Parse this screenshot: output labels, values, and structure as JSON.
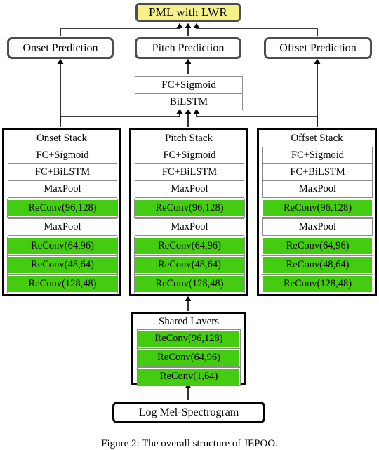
{
  "figure": {
    "caption": "Figure 2:  The overall structure of JEPOO.",
    "colors": {
      "highlight_yellow": "#f5f08a",
      "layer_green": "#44cc11",
      "box_border_gray": "#4d4d4d",
      "box_border_black": "#000000",
      "inner_border_gray": "#8c8c8c"
    }
  },
  "goal": {
    "label": "PML with LWR"
  },
  "predictions": [
    {
      "label": "Onset Prediction"
    },
    {
      "label": "Pitch Prediction"
    },
    {
      "label": "Offset Prediction"
    }
  ],
  "fusion": {
    "rows": [
      {
        "label": "FC+Sigmoid"
      },
      {
        "label": "BiLSTM"
      }
    ]
  },
  "stacks": [
    {
      "title": "Onset Stack",
      "layers": [
        {
          "label": "FC+Sigmoid",
          "green": false
        },
        {
          "label": "FC+BiLSTM",
          "green": false
        },
        {
          "label": "MaxPool",
          "green": false
        },
        {
          "label": "ReConv(96,128)",
          "green": true
        },
        {
          "label": "MaxPool",
          "green": false
        },
        {
          "label": "ReConv(64,96)",
          "green": true
        },
        {
          "label": "ReConv(48,64)",
          "green": true
        },
        {
          "label": "ReConv(128,48)",
          "green": true
        }
      ]
    },
    {
      "title": "Pitch Stack",
      "layers": [
        {
          "label": "FC+Sigmoid",
          "green": false
        },
        {
          "label": "FC+BiLSTM",
          "green": false
        },
        {
          "label": "MaxPool",
          "green": false
        },
        {
          "label": "ReConv(96,128)",
          "green": true
        },
        {
          "label": "MaxPool",
          "green": false
        },
        {
          "label": "ReConv(64,96)",
          "green": true
        },
        {
          "label": "ReConv(48,64)",
          "green": true
        },
        {
          "label": "ReConv(128,48)",
          "green": true
        }
      ]
    },
    {
      "title": "Offset Stack",
      "layers": [
        {
          "label": "FC+Sigmoid",
          "green": false
        },
        {
          "label": "FC+BiLSTM",
          "green": false
        },
        {
          "label": "MaxPool",
          "green": false
        },
        {
          "label": "ReConv(96,128)",
          "green": true
        },
        {
          "label": "MaxPool",
          "green": false
        },
        {
          "label": "ReConv(64,96)",
          "green": true
        },
        {
          "label": "ReConv(48,64)",
          "green": true
        },
        {
          "label": "ReConv(128,48)",
          "green": true
        }
      ]
    }
  ],
  "shared": {
    "title": "Shared Layers",
    "layers": [
      {
        "label": "ReConv(96,128)",
        "green": true
      },
      {
        "label": "ReConv(64,96)",
        "green": true
      },
      {
        "label": "ReConv(1,64)",
        "green": true
      }
    ]
  },
  "input": {
    "label": "Log Mel-Spectrogram"
  }
}
